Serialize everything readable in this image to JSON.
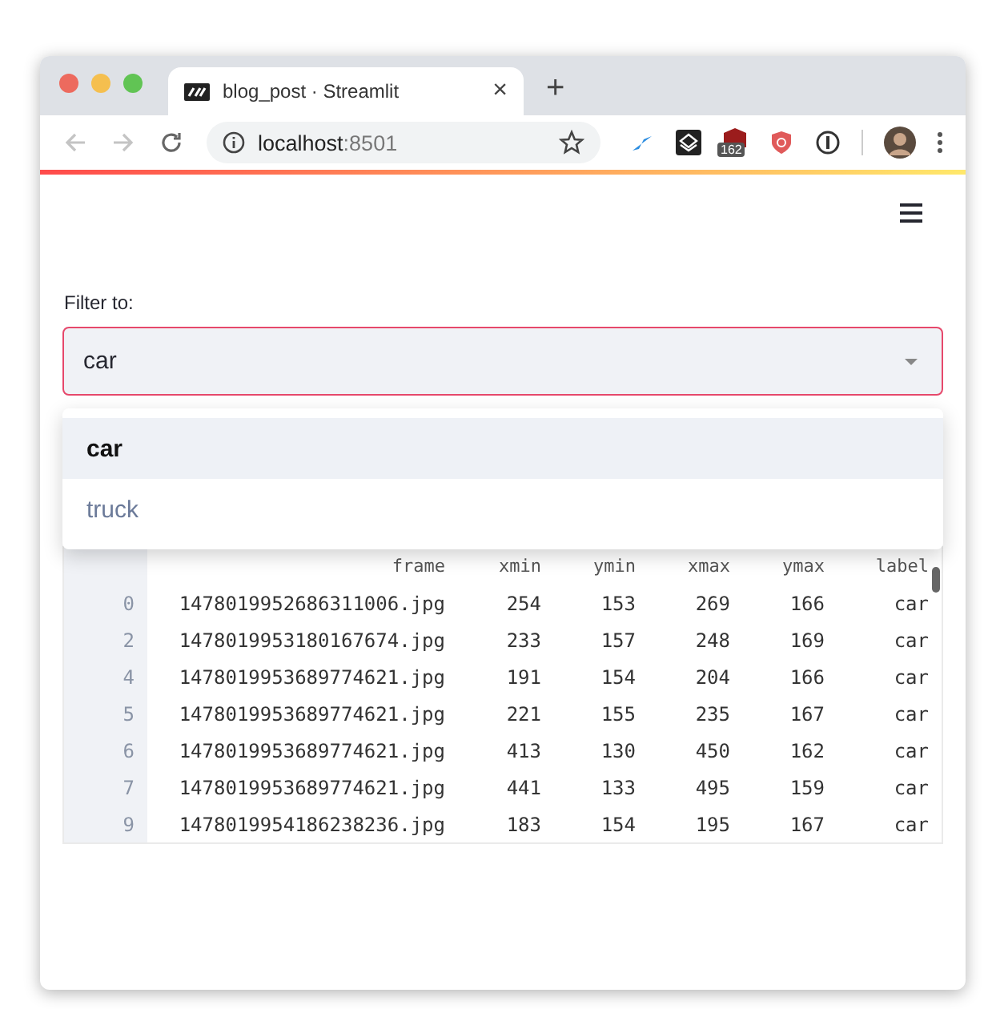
{
  "browser": {
    "tab_title": "blog_post · Streamlit",
    "tab_close": "×",
    "new_tab": "+",
    "url_host": "localhost",
    "url_port": ":8501",
    "extension_badge": "162"
  },
  "app": {
    "filter_label": "Filter to:",
    "select_value": "car",
    "select_focused": true,
    "options": [
      {
        "label": "car",
        "selected": true
      },
      {
        "label": "truck",
        "selected": false
      }
    ],
    "table": {
      "columns": [
        "frame",
        "xmin",
        "ymin",
        "xmax",
        "ymax",
        "label"
      ],
      "rows": [
        {
          "index": "0",
          "cells": [
            "1478019952686311006.jpg",
            "254",
            "153",
            "269",
            "166",
            "car"
          ]
        },
        {
          "index": "2",
          "cells": [
            "1478019953180167674.jpg",
            "233",
            "157",
            "248",
            "169",
            "car"
          ]
        },
        {
          "index": "4",
          "cells": [
            "1478019953689774621.jpg",
            "191",
            "154",
            "204",
            "166",
            "car"
          ]
        },
        {
          "index": "5",
          "cells": [
            "1478019953689774621.jpg",
            "221",
            "155",
            "235",
            "167",
            "car"
          ]
        },
        {
          "index": "6",
          "cells": [
            "1478019953689774621.jpg",
            "413",
            "130",
            "450",
            "162",
            "car"
          ]
        },
        {
          "index": "7",
          "cells": [
            "1478019953689774621.jpg",
            "441",
            "133",
            "495",
            "159",
            "car"
          ]
        },
        {
          "index": "9",
          "cells": [
            "1478019954186238236.jpg",
            "183",
            "154",
            "195",
            "167",
            "car"
          ]
        }
      ]
    }
  }
}
